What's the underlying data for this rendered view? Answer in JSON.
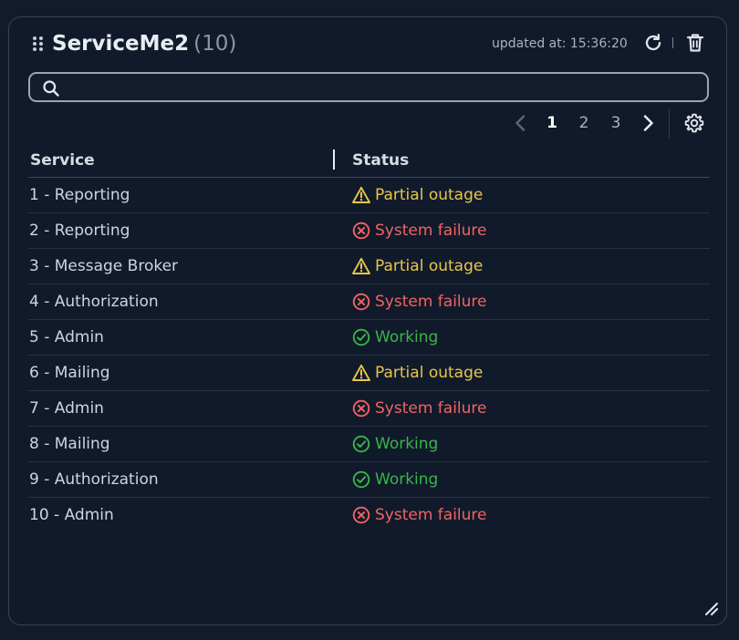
{
  "widget": {
    "title": "ServiceMe2",
    "count": "(10)",
    "updated_text": "updated at: 15:36:20",
    "icons": {
      "drag": "drag-handle-icon",
      "refresh": "refresh-icon",
      "delete": "trash-icon",
      "search": "search-icon",
      "settings": "gear-icon",
      "resize": "resize-corner-icon"
    }
  },
  "search": {
    "value": "",
    "placeholder": ""
  },
  "pagination": {
    "pages": [
      "1",
      "2",
      "3"
    ],
    "current": "1",
    "prev_label": "previous page",
    "next_label": "next page"
  },
  "table": {
    "columns": [
      "Service",
      "Status"
    ],
    "rows": [
      {
        "service": "1 - Reporting",
        "status": "Partial outage",
        "kind": "warning"
      },
      {
        "service": "2 - Reporting",
        "status": "System failure",
        "kind": "error"
      },
      {
        "service": "3 - Message Broker",
        "status": "Partial outage",
        "kind": "warning"
      },
      {
        "service": "4 - Authorization",
        "status": "System failure",
        "kind": "error"
      },
      {
        "service": "5 - Admin",
        "status": "Working",
        "kind": "ok"
      },
      {
        "service": "6 - Mailing",
        "status": "Partial outage",
        "kind": "warning"
      },
      {
        "service": "7 - Admin",
        "status": "System failure",
        "kind": "error"
      },
      {
        "service": "8 - Mailing",
        "status": "Working",
        "kind": "ok"
      },
      {
        "service": "9 - Authorization",
        "status": "Working",
        "kind": "ok"
      },
      {
        "service": "10 - Admin",
        "status": "System failure",
        "kind": "error"
      }
    ]
  },
  "colors": {
    "background": "#131b2b",
    "card": "#111a2a",
    "warning": "#e8c64a",
    "error": "#f06464",
    "ok": "#39b54a",
    "text": "#cfd5de"
  }
}
